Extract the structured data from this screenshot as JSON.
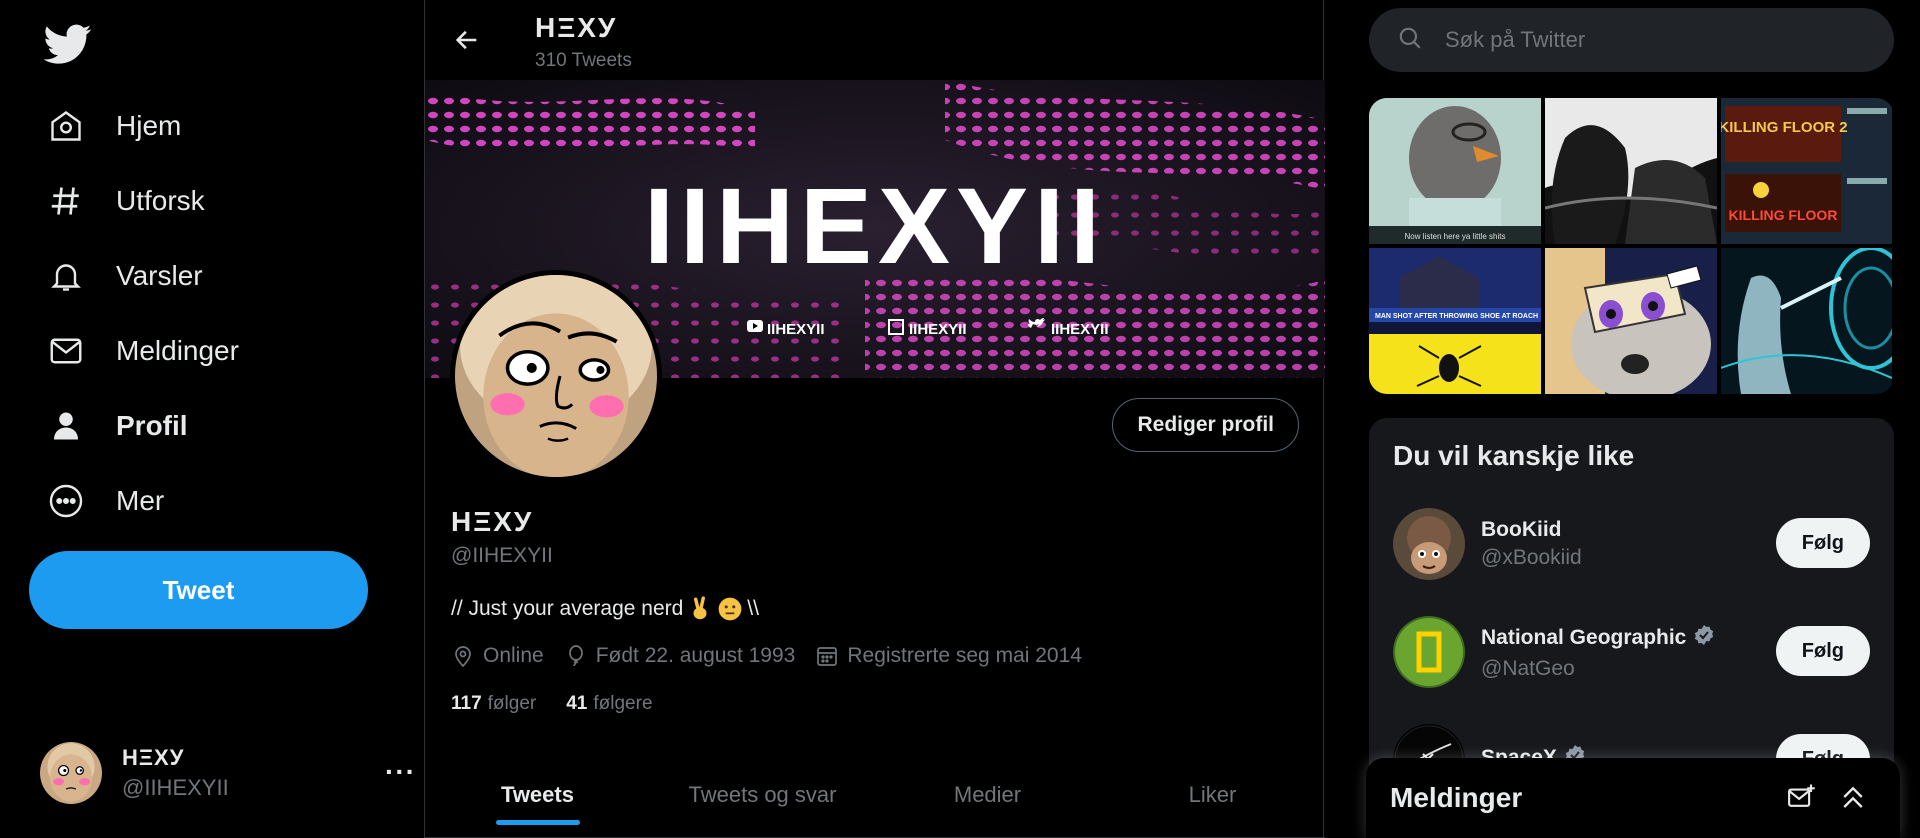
{
  "nav": {
    "items": [
      {
        "label": "Hjem",
        "icon": "home-icon"
      },
      {
        "label": "Utforsk",
        "icon": "hashtag-icon"
      },
      {
        "label": "Varsler",
        "icon": "bell-icon"
      },
      {
        "label": "Meldinger",
        "icon": "mail-icon"
      },
      {
        "label": "Profil",
        "icon": "person-icon",
        "active": true
      },
      {
        "label": "Mer",
        "icon": "more-circle-icon"
      }
    ],
    "tweet_button": "Tweet"
  },
  "account": {
    "name": "HΞXУ",
    "handle": "@IIHEXYII",
    "more": "···"
  },
  "header": {
    "name": "HΞXУ",
    "tweet_count": "310 Tweets"
  },
  "banner": {
    "logo_text": "IIHEXYII",
    "socials": [
      {
        "platform": "youtube",
        "text": "IIHEXYII"
      },
      {
        "platform": "twitch",
        "text": "IIHEXYII"
      },
      {
        "platform": "twitter",
        "text": "IIHEXYII"
      }
    ]
  },
  "profile": {
    "edit_button": "Rediger profil",
    "name": "HΞXУ",
    "handle": "@IIHEXYII",
    "bio_text": "// Just your average nerd",
    "bio_suffix": "\\\\",
    "location": "Online",
    "birthday": "Født 22. august 1993",
    "joined": "Registrerte seg mai 2014",
    "following_count": "117",
    "following_label": "følger",
    "followers_count": "41",
    "followers_label": "følgere"
  },
  "tabs": [
    {
      "label": "Tweets",
      "active": true
    },
    {
      "label": "Tweets og svar"
    },
    {
      "label": "Medier"
    },
    {
      "label": "Liker"
    }
  ],
  "search": {
    "placeholder": "Søk på Twitter"
  },
  "media": {
    "caption_1": "Now listen here ya little shits",
    "caption_2": "MAN SHOT AFTER THROWING SHOE AT ROACH",
    "game_1": "KILLING FLOOR 2",
    "game_2": "KILLING FLOOR"
  },
  "suggestions": {
    "title": "Du vil kanskje like",
    "follow_label": "Følg",
    "users": [
      {
        "name": "BooKiid",
        "handle": "@xBookiid",
        "verified": false
      },
      {
        "name": "National Geographic",
        "handle": "@NatGeo",
        "verified": true
      },
      {
        "name": "SpaceX",
        "handle": "",
        "verified": true
      }
    ]
  },
  "messages_drawer": {
    "title": "Meldinger"
  },
  "colors": {
    "accent": "#1d9bf0",
    "background": "#000000",
    "muted": "#71767b",
    "banner_dots": "#e64bd0"
  }
}
